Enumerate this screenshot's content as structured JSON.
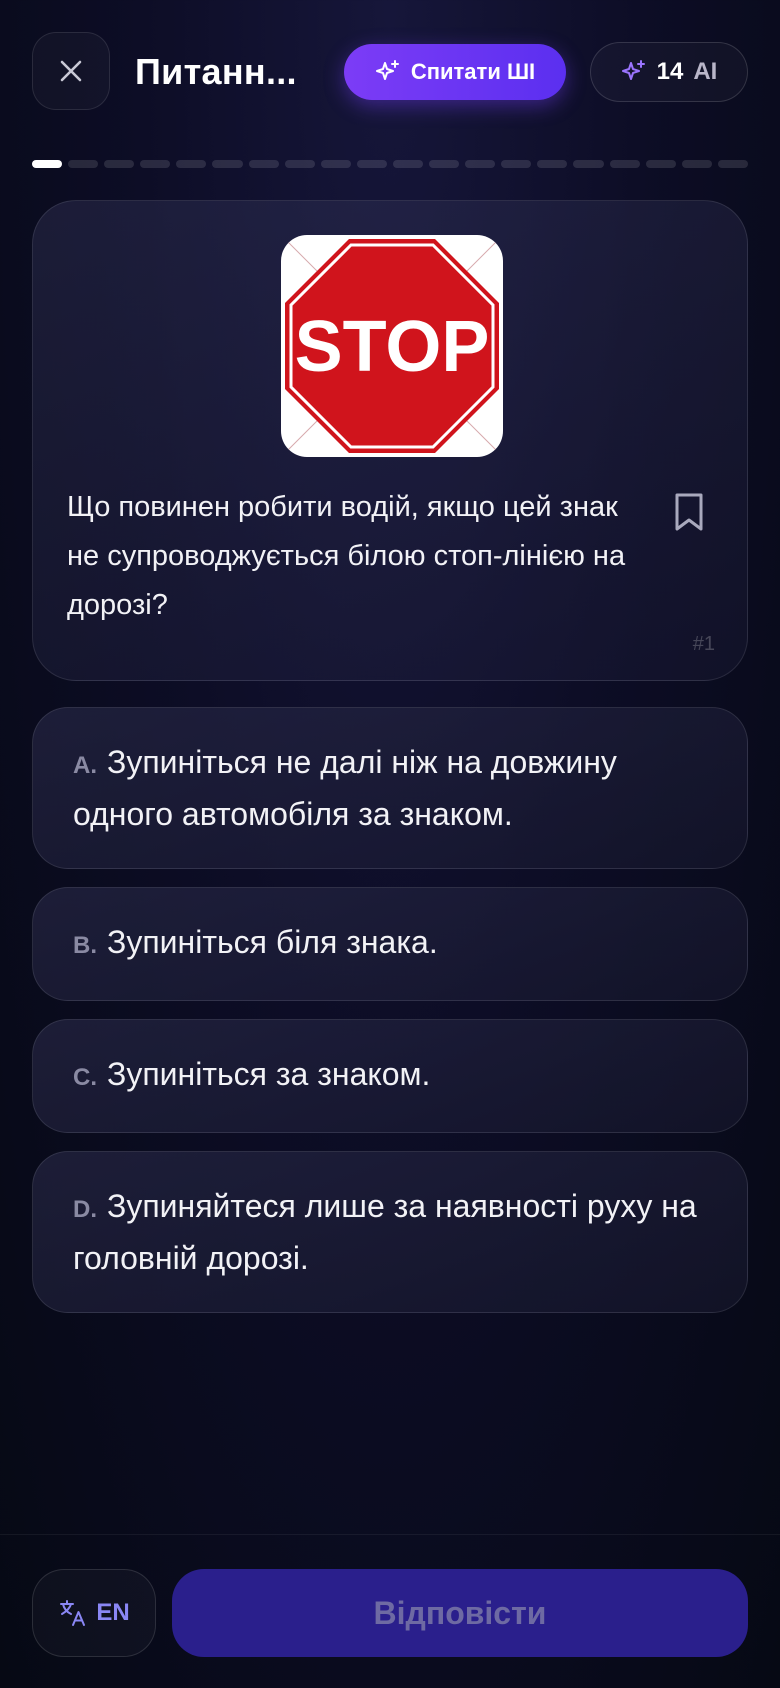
{
  "header": {
    "title": "Питанн...",
    "ask_ai_label": "Спитати ШІ",
    "credits_count": "14",
    "credits_unit": "AI"
  },
  "progress": {
    "total_segments": 20,
    "current_segment": 1
  },
  "question": {
    "sign_text": "STOP",
    "text": "Що повинен робити водій, якщо цей знак не супроводжується білою стоп-лінією на дорозі?",
    "number": "#1"
  },
  "options": [
    {
      "letter": "A.",
      "text": "Зупиніться не далі ніж на довжину одного автомобіля за знаком."
    },
    {
      "letter": "B.",
      "text": "Зупиніться біля знака."
    },
    {
      "letter": "C.",
      "text": "Зупиніться за знаком."
    },
    {
      "letter": "D.",
      "text": "Зупиняйтеся лише за наявності руху на головній дорозі."
    }
  ],
  "footer": {
    "language_label": "EN",
    "answer_label": "Відповісти"
  },
  "colors": {
    "accent": "#6b35f3",
    "answer_button_disabled": "#2a1f8c",
    "sign_red": "#d0141c"
  },
  "icons": [
    "close-icon",
    "sparkle-icon",
    "bookmark-icon",
    "translate-icon"
  ]
}
